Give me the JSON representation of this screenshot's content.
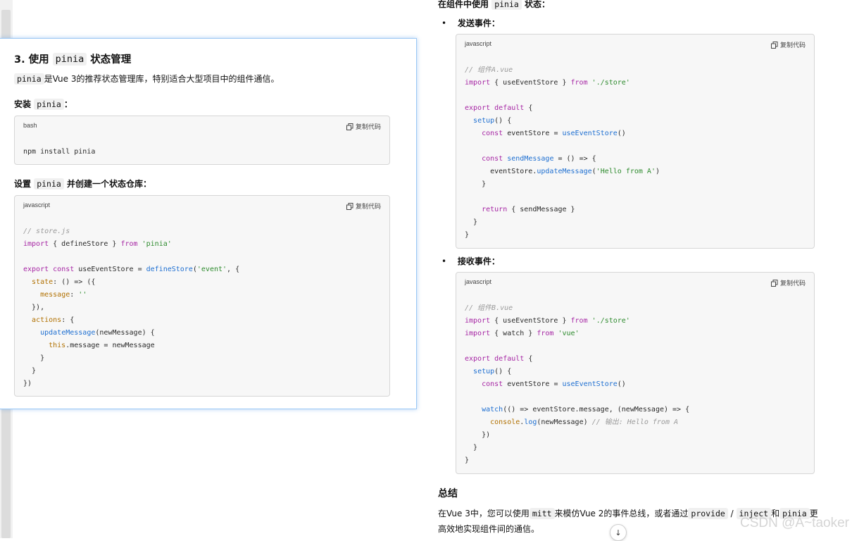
{
  "left_section": {
    "title_prefix": "3. 使用",
    "title_code": "pinia",
    "title_suffix": "状态管理",
    "intro_code": "pinia",
    "intro_text": "是Vue 3的推荐状态管理库，特别适合大型项目中的组件通信。",
    "install_prefix": "安装",
    "install_code": "pinia",
    "install_suffix": "：",
    "setup_prefix": "设置",
    "setup_code": "pinia",
    "setup_suffix": "并创建一个状态仓库："
  },
  "copy_label": "复制代码",
  "code_blocks": {
    "install": {
      "lang": "bash",
      "lines": [
        [
          [
            "",
            "npm install pinia"
          ]
        ]
      ]
    },
    "store": {
      "lang": "javascript",
      "lines": [
        [
          [
            "c",
            "// store.js"
          ]
        ],
        [
          [
            "k",
            "import"
          ],
          [
            "",
            " { defineStore } "
          ],
          [
            "k",
            "from"
          ],
          [
            "",
            " "
          ],
          [
            "s",
            "'pinia'"
          ]
        ],
        [],
        [
          [
            "k",
            "export"
          ],
          [
            "",
            " "
          ],
          [
            "k",
            "const"
          ],
          [
            "",
            " useEventStore = "
          ],
          [
            "f",
            "defineStore"
          ],
          [
            "",
            "("
          ],
          [
            "s",
            "'event'"
          ],
          [
            "",
            ", {"
          ]
        ],
        [
          [
            "",
            "  "
          ],
          [
            "p",
            "state"
          ],
          [
            "",
            ": () => ({"
          ]
        ],
        [
          [
            "",
            "    "
          ],
          [
            "p",
            "message"
          ],
          [
            "",
            ": "
          ],
          [
            "s",
            "''"
          ]
        ],
        [
          [
            "",
            "  }),"
          ]
        ],
        [
          [
            "",
            "  "
          ],
          [
            "p",
            "actions"
          ],
          [
            "",
            ": {"
          ]
        ],
        [
          [
            "",
            "    "
          ],
          [
            "f",
            "updateMessage"
          ],
          [
            "",
            "(newMessage) {"
          ]
        ],
        [
          [
            "",
            "      "
          ],
          [
            "p",
            "this"
          ],
          [
            "",
            ".message = newMessage"
          ]
        ],
        [
          [
            "",
            "    }"
          ]
        ],
        [
          [
            "",
            "  }"
          ]
        ],
        [
          [
            "",
            "})"
          ]
        ]
      ]
    },
    "component_a": {
      "lang": "javascript",
      "lines": [
        [
          [
            "c",
            "// 组件A.vue"
          ]
        ],
        [
          [
            "k",
            "import"
          ],
          [
            "",
            " { useEventStore } "
          ],
          [
            "k",
            "from"
          ],
          [
            "",
            " "
          ],
          [
            "s",
            "'./store'"
          ]
        ],
        [],
        [
          [
            "k",
            "export"
          ],
          [
            "",
            " "
          ],
          [
            "k",
            "default"
          ],
          [
            "",
            " {"
          ]
        ],
        [
          [
            "",
            "  "
          ],
          [
            "f",
            "setup"
          ],
          [
            "",
            "() {"
          ]
        ],
        [
          [
            "",
            "    "
          ],
          [
            "k",
            "const"
          ],
          [
            "",
            " eventStore = "
          ],
          [
            "f",
            "useEventStore"
          ],
          [
            "",
            "()"
          ]
        ],
        [],
        [
          [
            "",
            "    "
          ],
          [
            "k",
            "const"
          ],
          [
            "",
            " "
          ],
          [
            "f",
            "sendMessage"
          ],
          [
            "",
            " = () => {"
          ]
        ],
        [
          [
            "",
            "      eventStore."
          ],
          [
            "f",
            "updateMessage"
          ],
          [
            "",
            "("
          ],
          [
            "s",
            "'Hello from A'"
          ],
          [
            "",
            ")"
          ]
        ],
        [
          [
            "",
            "    }"
          ]
        ],
        [],
        [
          [
            "",
            "    "
          ],
          [
            "k",
            "return"
          ],
          [
            "",
            " { sendMessage }"
          ]
        ],
        [
          [
            "",
            "  }"
          ]
        ],
        [
          [
            "",
            "}"
          ]
        ]
      ]
    },
    "component_b": {
      "lang": "javascript",
      "lines": [
        [
          [
            "c",
            "// 组件B.vue"
          ]
        ],
        [
          [
            "k",
            "import"
          ],
          [
            "",
            " { useEventStore } "
          ],
          [
            "k",
            "from"
          ],
          [
            "",
            " "
          ],
          [
            "s",
            "'./store'"
          ]
        ],
        [
          [
            "k",
            "import"
          ],
          [
            "",
            " { watch } "
          ],
          [
            "k",
            "from"
          ],
          [
            "",
            " "
          ],
          [
            "s",
            "'vue'"
          ]
        ],
        [],
        [
          [
            "k",
            "export"
          ],
          [
            "",
            " "
          ],
          [
            "k",
            "default"
          ],
          [
            "",
            " {"
          ]
        ],
        [
          [
            "",
            "  "
          ],
          [
            "f",
            "setup"
          ],
          [
            "",
            "() {"
          ]
        ],
        [
          [
            "",
            "    "
          ],
          [
            "k",
            "const"
          ],
          [
            "",
            " eventStore = "
          ],
          [
            "f",
            "useEventStore"
          ],
          [
            "",
            "()"
          ]
        ],
        [],
        [
          [
            "",
            "    "
          ],
          [
            "f",
            "watch"
          ],
          [
            "",
            "(() => eventStore.message, (newMessage) => {"
          ]
        ],
        [
          [
            "",
            "      "
          ],
          [
            "p",
            "console"
          ],
          [
            "",
            "."
          ],
          [
            "f",
            "log"
          ],
          [
            "",
            "(newMessage) "
          ],
          [
            "c",
            "// 输出: Hello from A"
          ]
        ],
        [
          [
            "",
            "    })"
          ]
        ],
        [
          [
            "",
            "  }"
          ]
        ],
        [
          [
            "",
            "}"
          ]
        ]
      ]
    }
  },
  "right_section": {
    "heading_prefix": "在组件中使用",
    "heading_code": "pinia",
    "heading_suffix": "状态：",
    "bullet_send": "发送事件：",
    "bullet_receive": "接收事件：",
    "summary_title": "总结",
    "summary": {
      "t1": "在Vue 3中，您可以使用",
      "c1": "mitt",
      "t2": "来模仿Vue 2的事件总线，或者通过",
      "c2": "provide",
      "t3": " / ",
      "c3": "inject",
      "t4": "和",
      "c4": "pinia",
      "t5": "更高效地实现组件间的通信。"
    }
  },
  "watermark": "CSDN @A~taoker",
  "scroll_down_glyph": "↓"
}
